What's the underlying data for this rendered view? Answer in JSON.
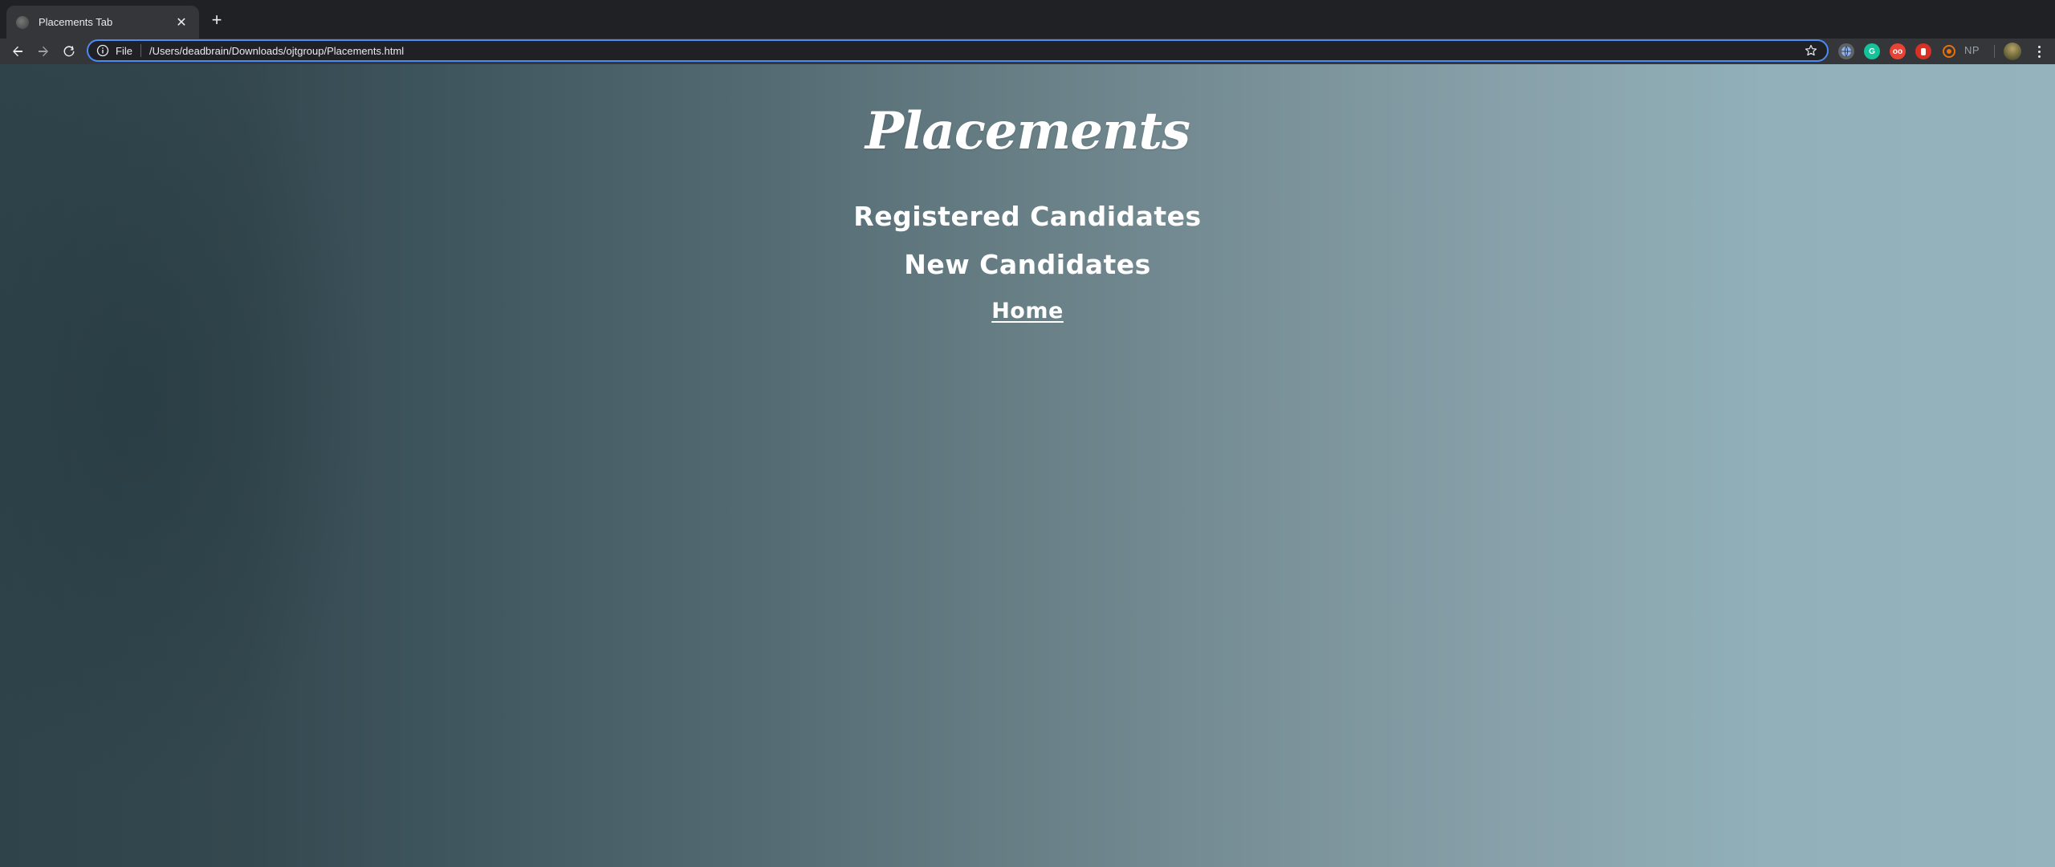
{
  "browser": {
    "tab": {
      "title": "Placements Tab",
      "close_glyph": "✕"
    },
    "new_tab_glyph": "+",
    "omnibox": {
      "scheme_label": "File",
      "url": "/Users/deadbrain/Downloads/ojtgroup/Placements.html"
    },
    "extensions": [
      {
        "name": "globe-extension-icon",
        "color": "#8ab4f8"
      },
      {
        "name": "grammarly-extension-icon",
        "color": "#15c39a"
      },
      {
        "name": "tracker-extension-icon",
        "color": "#ea4335"
      },
      {
        "name": "adblock-extension-icon",
        "color": "#d93025"
      },
      {
        "name": "target-extension-icon",
        "color": "#e8710a"
      }
    ],
    "np_label": "NP"
  },
  "page": {
    "title": "Placements",
    "links": {
      "registered": "Registered Candidates",
      "new": "New Candidates",
      "home": "Home"
    }
  },
  "colors": {
    "omnibox_focus": "#4c8bf5",
    "text": "#ffffff"
  }
}
